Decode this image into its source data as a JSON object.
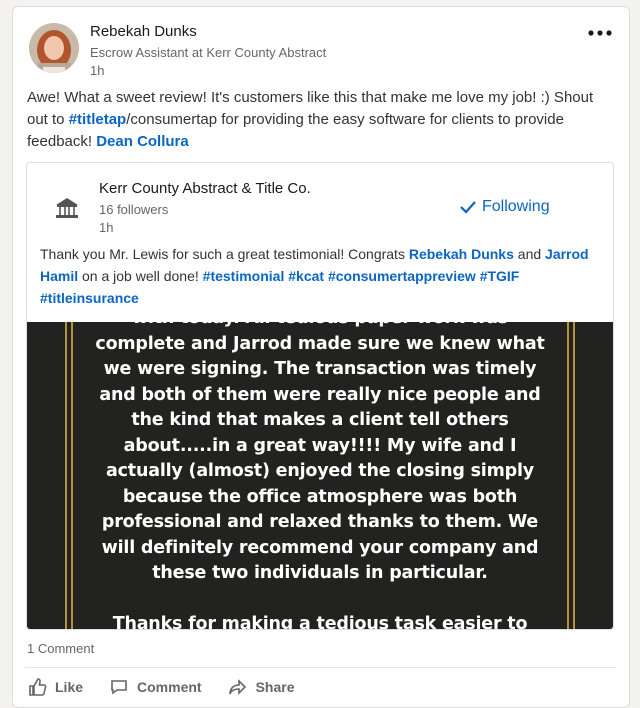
{
  "post": {
    "author": {
      "name": "Rebekah Dunks",
      "headline": "Escrow Assistant at Kerr County Abstract",
      "time": "1h"
    },
    "text": {
      "part1": "Awe! What a sweet review! It's customers like this that make me love my job! :) Shout out to ",
      "hashtag": "#titletap",
      "part2": "/consumertap for providing the easy software for clients to provide feedback! ",
      "mention": "Dean Collura"
    },
    "more_icon": "ellipsis-icon"
  },
  "reshare": {
    "company_name": "Kerr County Abstract & Title Co.",
    "followers": "16 followers",
    "time": "1h",
    "follow_label": "Following",
    "follow_icon": "check-icon",
    "text": {
      "t1": "Thank you Mr. Lewis for such a great testimonial! Congrats ",
      "mention1": "Rebekah Dunks",
      "t2": " and ",
      "mention2": "Jarrod Hamil",
      "t3": " on a job well done! ",
      "tags": [
        "#testimonial",
        "#kcat",
        "#consumertappreview",
        "#TGIF",
        "#titleinsurance"
      ]
    },
    "review_lines": [
      "with today. All tedious paper work was",
      "complete and Jarrod made sure we knew what",
      "we were signing. The transaction was timely",
      "and both of them were really nice people and",
      "the kind that makes a client tell others",
      "about.....in a great way!!!! My wife and I",
      "actually (almost) enjoyed the closing simply",
      "because the office atmosphere was both",
      "professional and relaxed thanks to them. We",
      "will definitely recommend your company and",
      "these two individuals in particular."
    ],
    "review_thanks": "Thanks for making a tedious task easier to",
    "colors": {
      "image_bg": "#222221",
      "frame_gold": "#b8923a"
    }
  },
  "social": {
    "comment_count": "1 Comment",
    "actions": {
      "like": "Like",
      "comment": "Comment",
      "share": "Share"
    }
  },
  "colors": {
    "link": "#0a66c2",
    "page_bg": "#f3f2ef",
    "card_bg": "#ffffff"
  }
}
